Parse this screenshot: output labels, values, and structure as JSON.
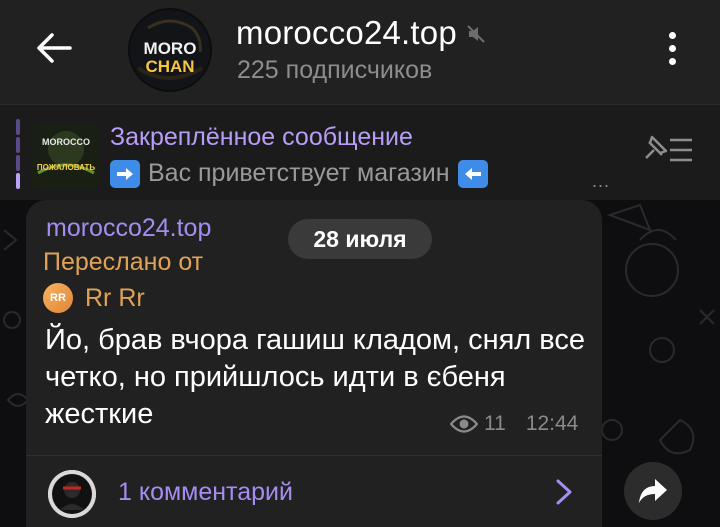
{
  "header": {
    "title": "morocco24.top",
    "subscribers": "225 подписчиков",
    "avatar_text_top": "MORO",
    "avatar_text_bottom": "CHAN"
  },
  "pinned": {
    "title": "Закреплённое сообщение",
    "text": "Вас приветствует магазин",
    "more": "...",
    "thumb_text_top": "MOROCCO",
    "thumb_text_bottom": "ПОЖАЛОВАТЬ"
  },
  "date": "28 июля",
  "message": {
    "sender": "morocco24.top",
    "forwarded_label": "Переслано от",
    "forwarded_name": "Rr Rr",
    "forwarded_initials": "RR",
    "text": "Йо, брав вчора гашиш кладом, снял все четко, но прийшлось идти в єбеня жесткие",
    "views": "11",
    "time": "12:44"
  },
  "comments": {
    "label": "1 комментарий"
  },
  "icons": {
    "back": "arrow-left-icon",
    "mute": "muted-speaker-icon",
    "more": "three-dots-vertical-icon",
    "pinned_list": "pinned-list-icon",
    "views": "eye-icon",
    "chevron": "chevron-right-icon",
    "share": "share-arrow-icon",
    "arrow_right_emoji": "arrow-right-emoji",
    "arrow_left_emoji": "arrow-left-emoji"
  },
  "colors": {
    "accent": "#a58df0",
    "forward": "#e0a356",
    "header_bg": "#212121",
    "bubble_bg": "#212121",
    "pinned_bg": "#1b1b1b"
  }
}
